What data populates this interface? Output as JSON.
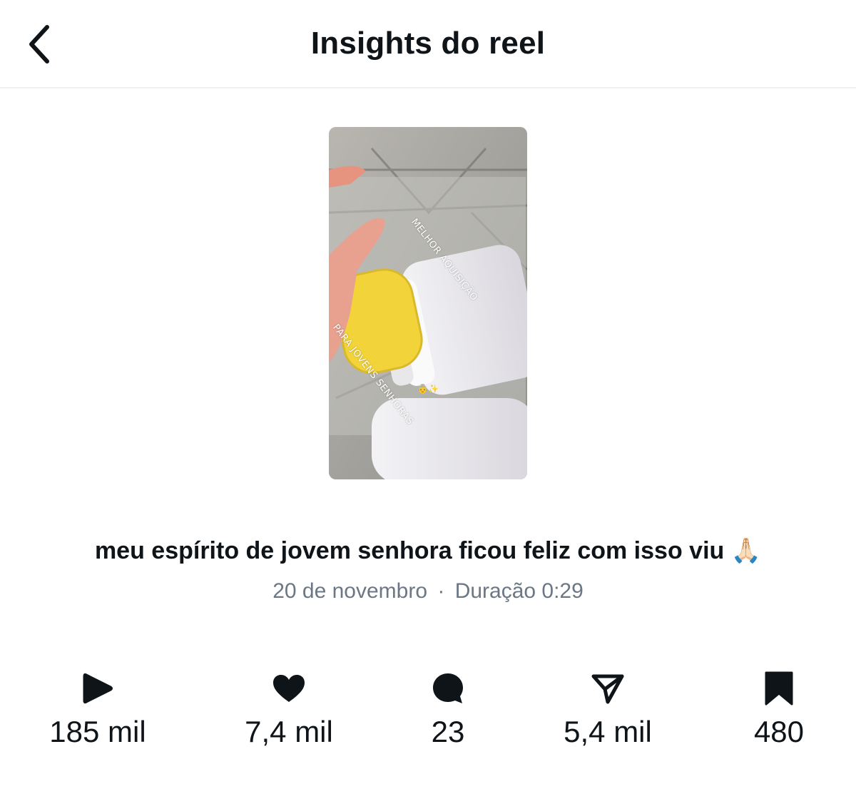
{
  "header": {
    "title": "Insights do reel",
    "back_icon": "chevron-left-icon"
  },
  "reel": {
    "overlay_line1": "MELHOR AQUISIÇÃO",
    "overlay_line2": "PARA JOVENS SENHORAS",
    "overlay_emoji": "👵✨",
    "caption": "meu espírito de jovem senhora ficou feliz com isso viu 🙏🏻",
    "date": "20 de novembro",
    "separator": "·",
    "duration": "Duração 0:29"
  },
  "stats": [
    {
      "icon": "play-icon",
      "value": "185 mil"
    },
    {
      "icon": "heart-icon",
      "value": "7,4 mil"
    },
    {
      "icon": "comment-icon",
      "value": "23"
    },
    {
      "icon": "share-icon",
      "value": "5,4 mil"
    },
    {
      "icon": "bookmark-icon",
      "value": "480"
    }
  ],
  "colors": {
    "text": "#0f1419",
    "secondary_text": "#6b7785",
    "divider": "#eef0f2",
    "sponge": "#f2d43a"
  }
}
